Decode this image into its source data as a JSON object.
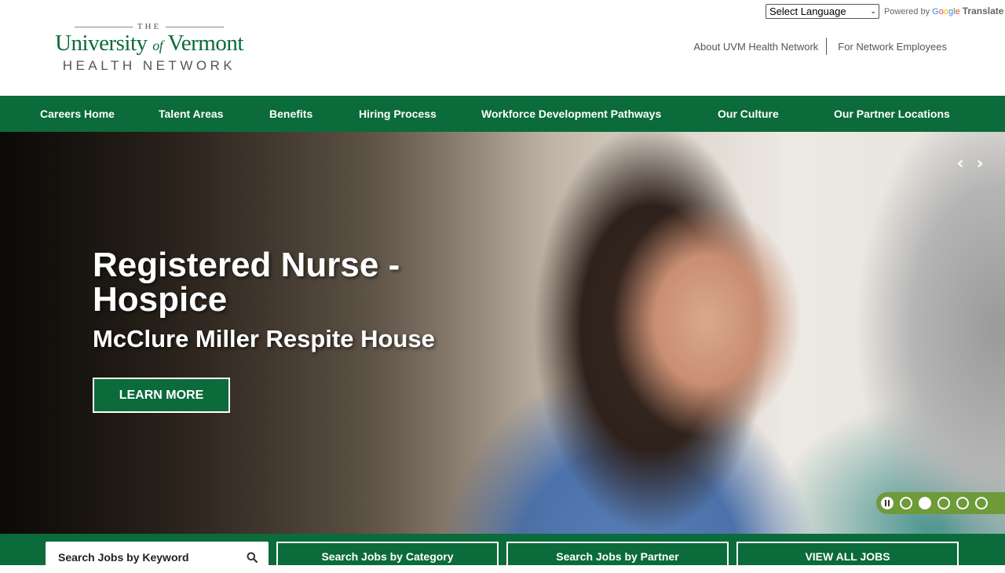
{
  "header": {
    "logo": {
      "the": "THE",
      "line1_a": "University",
      "line1_of": "of",
      "line1_b": "Vermont",
      "line2": "HEALTH NETWORK"
    },
    "translate": {
      "select_label": "Select Language",
      "powered_by": "Powered by",
      "google": "Google",
      "translate": "Translate"
    },
    "util_links": [
      "About UVM Health Network",
      "For Network Employees"
    ]
  },
  "nav": {
    "items": [
      "Careers Home",
      "Talent Areas",
      "Benefits",
      "Hiring Process",
      "Workforce Development Pathways",
      "Our Culture",
      "Our Partner Locations"
    ]
  },
  "hero": {
    "title": "Registered Nurse - Hospice",
    "subtitle": "McClure Miller Respite House",
    "cta": "LEARN MORE",
    "slides": {
      "count": 5,
      "active_index": 2
    }
  },
  "search": {
    "keyword_placeholder": "Search Jobs by Keyword",
    "buttons": [
      "Search Jobs by Category",
      "Search Jobs by Partner",
      "VIEW ALL JOBS"
    ]
  },
  "colors": {
    "brand_green": "#0b6b3a",
    "pager_green": "#6e9a3a"
  }
}
